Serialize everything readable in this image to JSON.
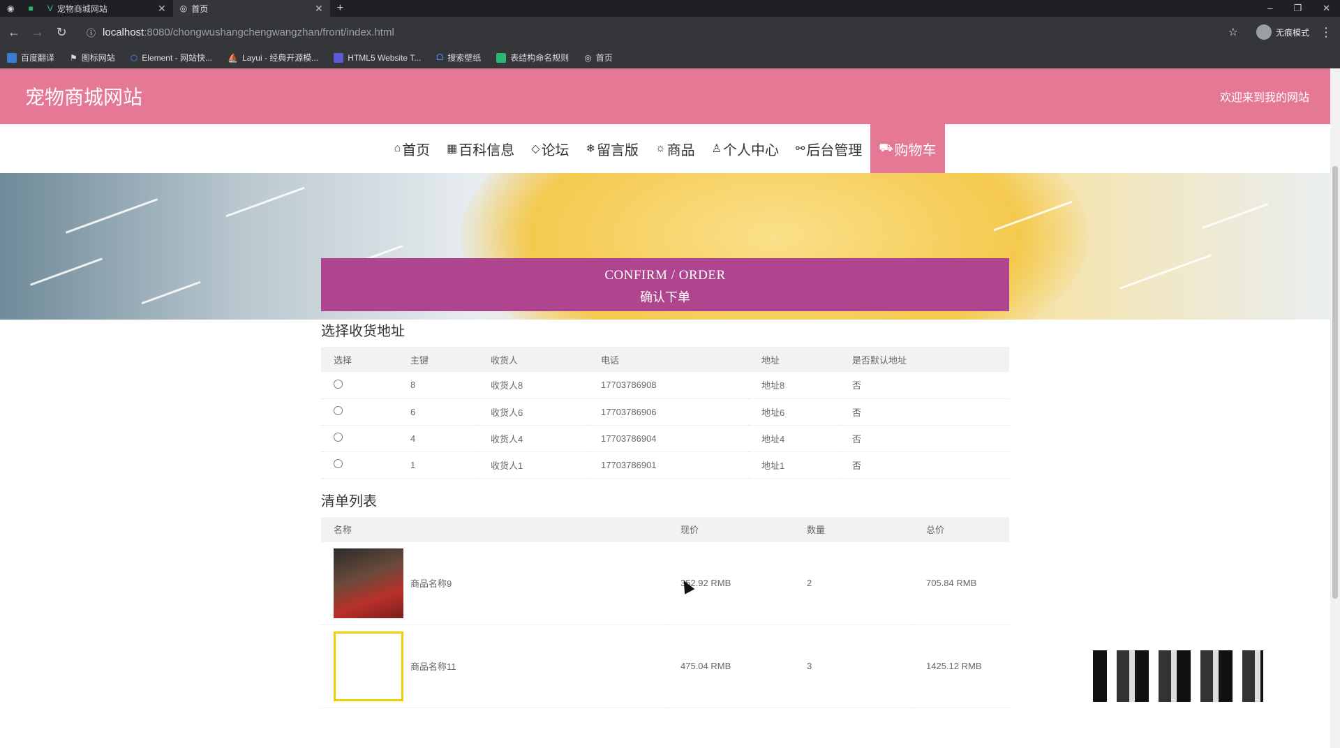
{
  "browser": {
    "tabs": [
      {
        "title": "宠物商城网站"
      },
      {
        "title": "首页"
      }
    ],
    "url_host": "localhost",
    "url_path": ":8080/chongwushangchengwangzhan/front/index.html",
    "profile_label": "无痕模式",
    "bookmarks": [
      "百度翻译",
      "图标网站",
      "Element - 网站快...",
      "Layui - 经典开源模...",
      "HTML5 Website T...",
      "搜索壁纸",
      "表结构命名规则",
      "首页"
    ]
  },
  "header": {
    "site_title": "宠物商城网站",
    "welcome": "欢迎来到我的网站"
  },
  "menu": [
    {
      "icon": "home-icon",
      "label": "首页"
    },
    {
      "icon": "grid-icon",
      "label": "百科信息"
    },
    {
      "icon": "tag-icon",
      "label": "论坛"
    },
    {
      "icon": "snowflake-icon",
      "label": "留言版"
    },
    {
      "icon": "gear-icon",
      "label": "商品"
    },
    {
      "icon": "user-icon",
      "label": "个人中心"
    },
    {
      "icon": "link-icon",
      "label": "后台管理"
    },
    {
      "icon": "cart-icon",
      "label": "购物车",
      "active": true
    }
  ],
  "confirm": {
    "en": "CONFIRM / ORDER",
    "cn": "确认下单"
  },
  "address_section": {
    "title": "选择收货地址",
    "columns": [
      "选择",
      "主键",
      "收货人",
      "电话",
      "地址",
      "是否默认地址"
    ],
    "rows": [
      {
        "id": "8",
        "name": "收货人8",
        "phone": "17703786908",
        "address": "地址8",
        "default": "否"
      },
      {
        "id": "6",
        "name": "收货人6",
        "phone": "17703786906",
        "address": "地址6",
        "default": "否"
      },
      {
        "id": "4",
        "name": "收货人4",
        "phone": "17703786904",
        "address": "地址4",
        "default": "否"
      },
      {
        "id": "1",
        "name": "收货人1",
        "phone": "17703786901",
        "address": "地址1",
        "default": "否"
      }
    ]
  },
  "order_section": {
    "title": "清单列表",
    "columns": [
      "名称",
      "现价",
      "数量",
      "总价"
    ],
    "rows": [
      {
        "name": "商品名称9",
        "price": "352.92 RMB",
        "qty": "2",
        "total": "705.84 RMB"
      },
      {
        "name": "商品名称11",
        "price": "475.04 RMB",
        "qty": "3",
        "total": "1425.12 RMB"
      }
    ]
  },
  "colors": {
    "header_pink": "#e57894",
    "confirm_purple": "#b0458f"
  }
}
